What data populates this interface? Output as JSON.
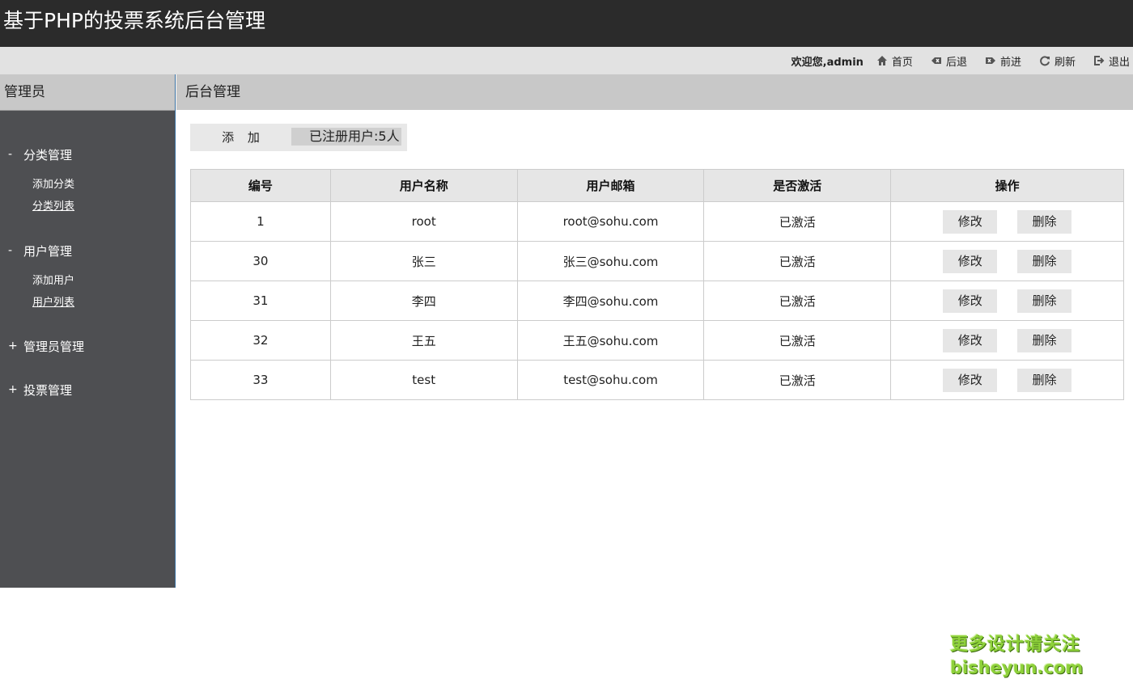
{
  "header": {
    "title": "基于PHP的投票系统后台管理"
  },
  "toolbar": {
    "welcome": "欢迎您,admin",
    "links": [
      {
        "label": "首页",
        "icon": "home-icon"
      },
      {
        "label": "后退",
        "icon": "back-icon"
      },
      {
        "label": "前进",
        "icon": "forward-icon"
      },
      {
        "label": "刷新",
        "icon": "refresh-icon"
      },
      {
        "label": "退出",
        "icon": "logout-icon"
      }
    ]
  },
  "sidebar": {
    "title": "管理员",
    "groups": [
      {
        "sign": "-",
        "label": "分类管理",
        "items": [
          "添加分类",
          "分类列表"
        ]
      },
      {
        "sign": "-",
        "label": "用户管理",
        "items": [
          "添加用户",
          "用户列表"
        ]
      },
      {
        "sign": "+",
        "label": "管理员管理",
        "items": []
      },
      {
        "sign": "+",
        "label": "投票管理",
        "items": []
      }
    ]
  },
  "main": {
    "title": "后台管理",
    "add_label": "添 加",
    "user_count": "已注册用户:5人",
    "table": {
      "columns": [
        "编号",
        "用户名称",
        "用户邮箱",
        "是否激活",
        "操作"
      ],
      "rows": [
        {
          "id": "1",
          "name": "root",
          "email": "root@sohu.com",
          "active": "已激活"
        },
        {
          "id": "30",
          "name": "张三",
          "email": "张三@sohu.com",
          "active": "已激活"
        },
        {
          "id": "31",
          "name": "李四",
          "email": "李四@sohu.com",
          "active": "已激活"
        },
        {
          "id": "32",
          "name": "王五",
          "email": "王五@sohu.com",
          "active": "已激活"
        },
        {
          "id": "33",
          "name": "test",
          "email": "test@sohu.com",
          "active": "已激活"
        }
      ],
      "edit_label": "修改",
      "delete_label": "删除"
    }
  },
  "watermark": {
    "line1": "更多设计请关注",
    "line2": "bisheyun.com"
  },
  "colors": {
    "topbar": "#2b2b2b",
    "sidebar": "#4e4f52",
    "watermark": "#8ed13a"
  }
}
